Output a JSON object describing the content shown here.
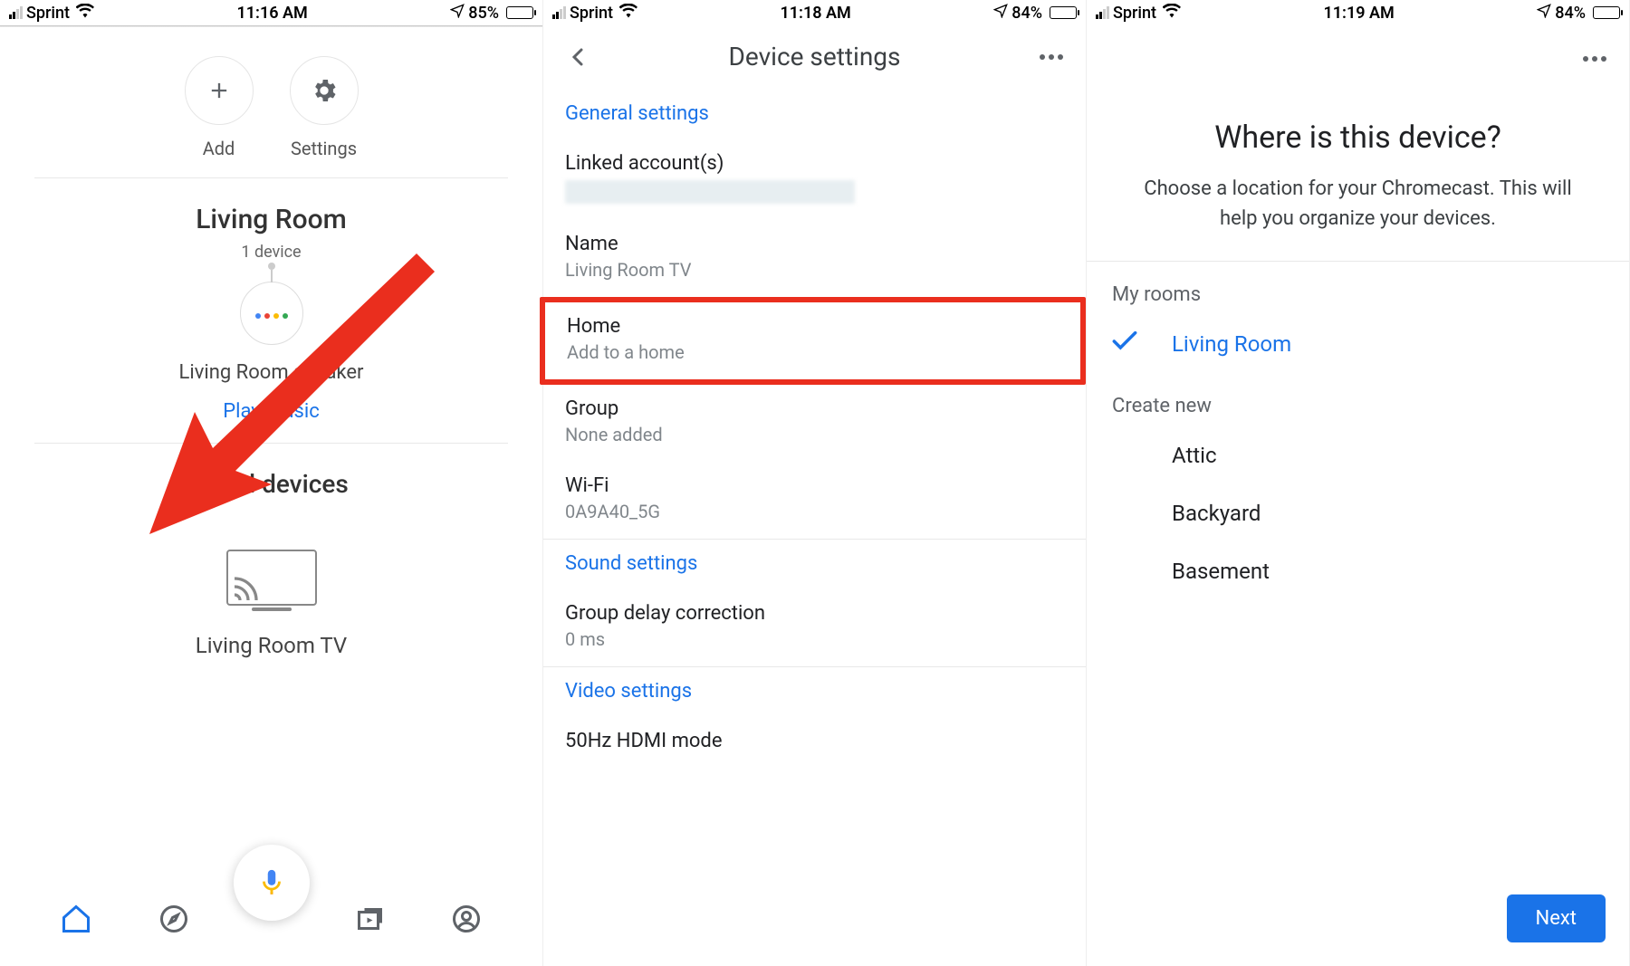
{
  "screen1": {
    "status": {
      "carrier": "Sprint",
      "time": "11:16 AM",
      "battery": "85%",
      "battery_fill": 85
    },
    "actions": {
      "add": "Add",
      "settings": "Settings"
    },
    "room": {
      "title": "Living Room",
      "sub": "1 device"
    },
    "speaker": {
      "name": "Living Room speaker",
      "play": "Play music"
    },
    "local": {
      "title": "Local devices",
      "cast_name": "Living Room TV"
    }
  },
  "screen2": {
    "status": {
      "carrier": "Sprint",
      "time": "11:18 AM",
      "battery": "84%",
      "battery_fill": 84
    },
    "header": {
      "title": "Device settings"
    },
    "sections": {
      "general": "General settings",
      "linked_label": "Linked account(s)",
      "name_label": "Name",
      "name_value": "Living Room TV",
      "home_label": "Home",
      "home_value": "Add to a home",
      "group_label": "Group",
      "group_value": "None added",
      "wifi_label": "Wi-Fi",
      "wifi_value": "0A9A40_5G",
      "sound": "Sound settings",
      "delay_label": "Group delay correction",
      "delay_value": "0 ms",
      "video": "Video settings",
      "hdmi_label": "50Hz HDMI mode"
    }
  },
  "screen3": {
    "status": {
      "carrier": "Sprint",
      "time": "11:19 AM",
      "battery": "84%",
      "battery_fill": 84
    },
    "title": "Where is this device?",
    "subtitle": "Choose a location for your Chromecast. This will help you organize your devices.",
    "my_rooms_label": "My rooms",
    "selected_room": "Living Room",
    "create_new_label": "Create new",
    "rooms": {
      "r1": "Attic",
      "r2": "Backyard",
      "r3": "Basement"
    },
    "next": "Next"
  }
}
